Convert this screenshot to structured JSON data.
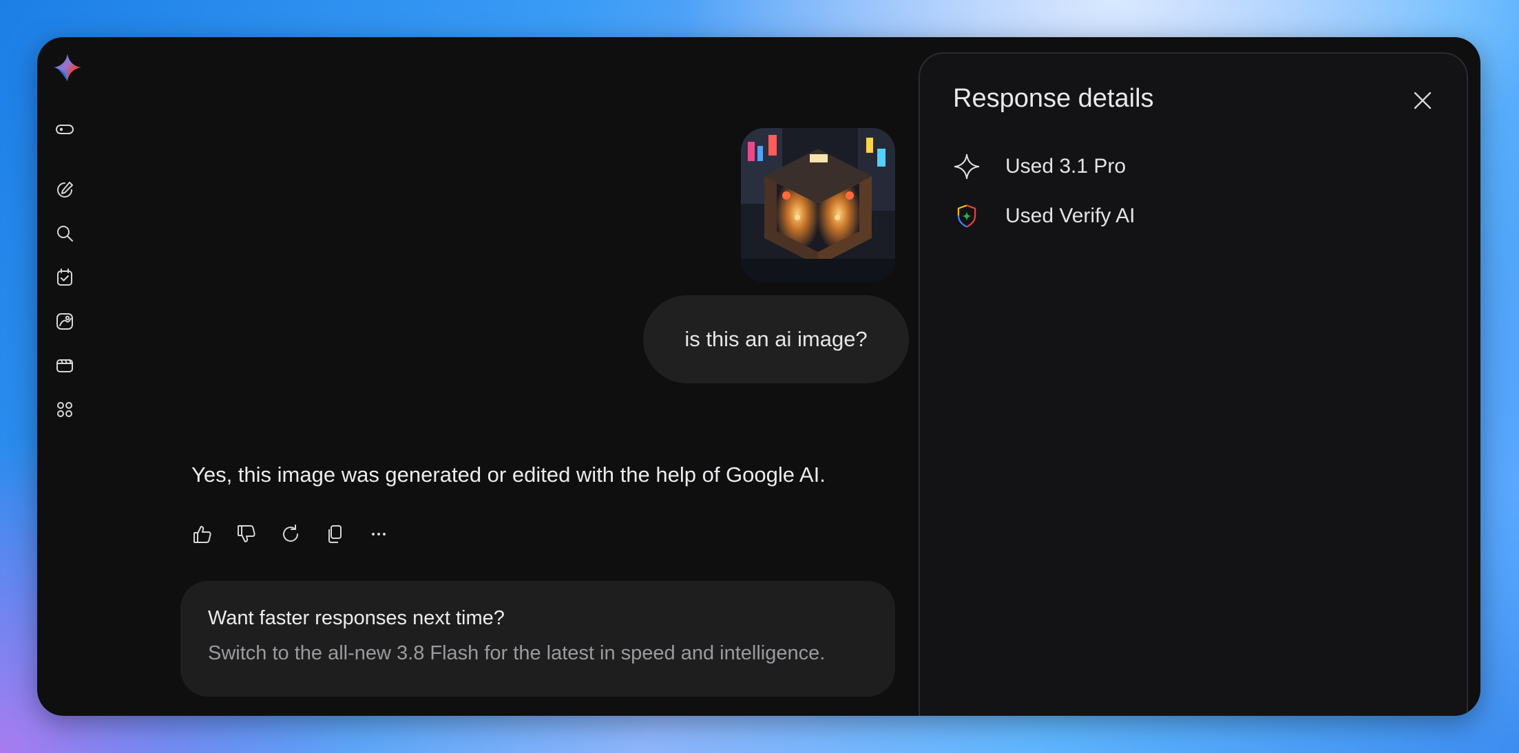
{
  "app": {
    "name": "Gemini"
  },
  "sidebar": {
    "icons": [
      "sidebar-toggle-icon",
      "new-chat-icon",
      "search-icon",
      "tasks-icon",
      "gallery-icon",
      "videos-icon",
      "apps-icon"
    ]
  },
  "conversation": {
    "user_message": "is this an ai image?",
    "user_image_alt": "isometric night market ramen stall illustration",
    "response_text": "Yes, this image was generated or edited with the help of Google AI.",
    "response_actions": [
      "thumbs-up",
      "thumbs-down",
      "regenerate",
      "copy",
      "more"
    ]
  },
  "promo": {
    "title": "Want faster responses next time?",
    "subtitle": "Switch to the all-new 3.8 Flash for the latest in speed and intelligence."
  },
  "details_panel": {
    "title": "Response details",
    "items": [
      {
        "label": "Used 3.1 Pro",
        "icon": "sparkle-icon"
      },
      {
        "label": "Used Verify AI",
        "icon": "shield-icon"
      }
    ]
  },
  "colors": {
    "window_bg": "#0f0f10",
    "panel_bg": "#131315",
    "bubble_bg": "#202021",
    "accent_blue": "#4285f4",
    "accent_red": "#ea4335",
    "accent_yellow": "#fbbc04",
    "accent_green": "#34a853"
  }
}
